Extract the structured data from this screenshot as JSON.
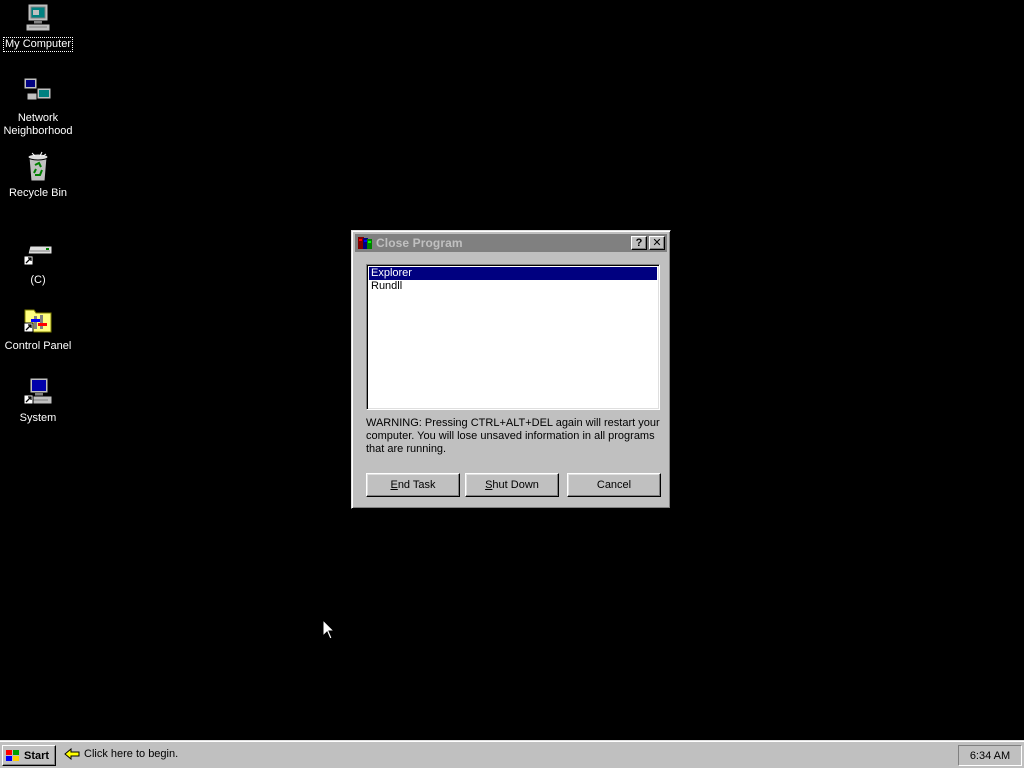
{
  "desktop": {
    "background": "#000000",
    "icons": [
      {
        "label": "My Computer",
        "icon": "my-computer-icon",
        "focused": true
      },
      {
        "label": "Network Neighborhood",
        "icon": "network-neighborhood-icon"
      },
      {
        "label": "Recycle Bin",
        "icon": "recycle-bin-icon"
      },
      {
        "label": "(C)",
        "icon": "drive-c-shortcut-icon"
      },
      {
        "label": "Control Panel",
        "icon": "control-panel-shortcut-icon"
      },
      {
        "label": "System",
        "icon": "system-shortcut-icon"
      }
    ]
  },
  "dialog": {
    "title": "Close Program",
    "help_button": "?",
    "close_button": "✕",
    "tasks": [
      {
        "name": "Explorer",
        "selected": true
      },
      {
        "name": "Rundll",
        "selected": false
      }
    ],
    "warning": "WARNING: Pressing CTRL+ALT+DEL again will restart your computer. You will lose unsaved information in all programs that are running.",
    "buttons": {
      "end_task": {
        "mnemonic": "E",
        "rest": "nd Task"
      },
      "shut_down": {
        "mnemonic": "S",
        "rest": "hut Down"
      },
      "cancel": "Cancel"
    },
    "colors": {
      "face": "#c0c0c0",
      "inactive_title": "#808080",
      "selection": "#000080"
    }
  },
  "taskbar": {
    "start_label": "Start",
    "hint": "Click here to begin.",
    "clock": "6:34 AM"
  }
}
